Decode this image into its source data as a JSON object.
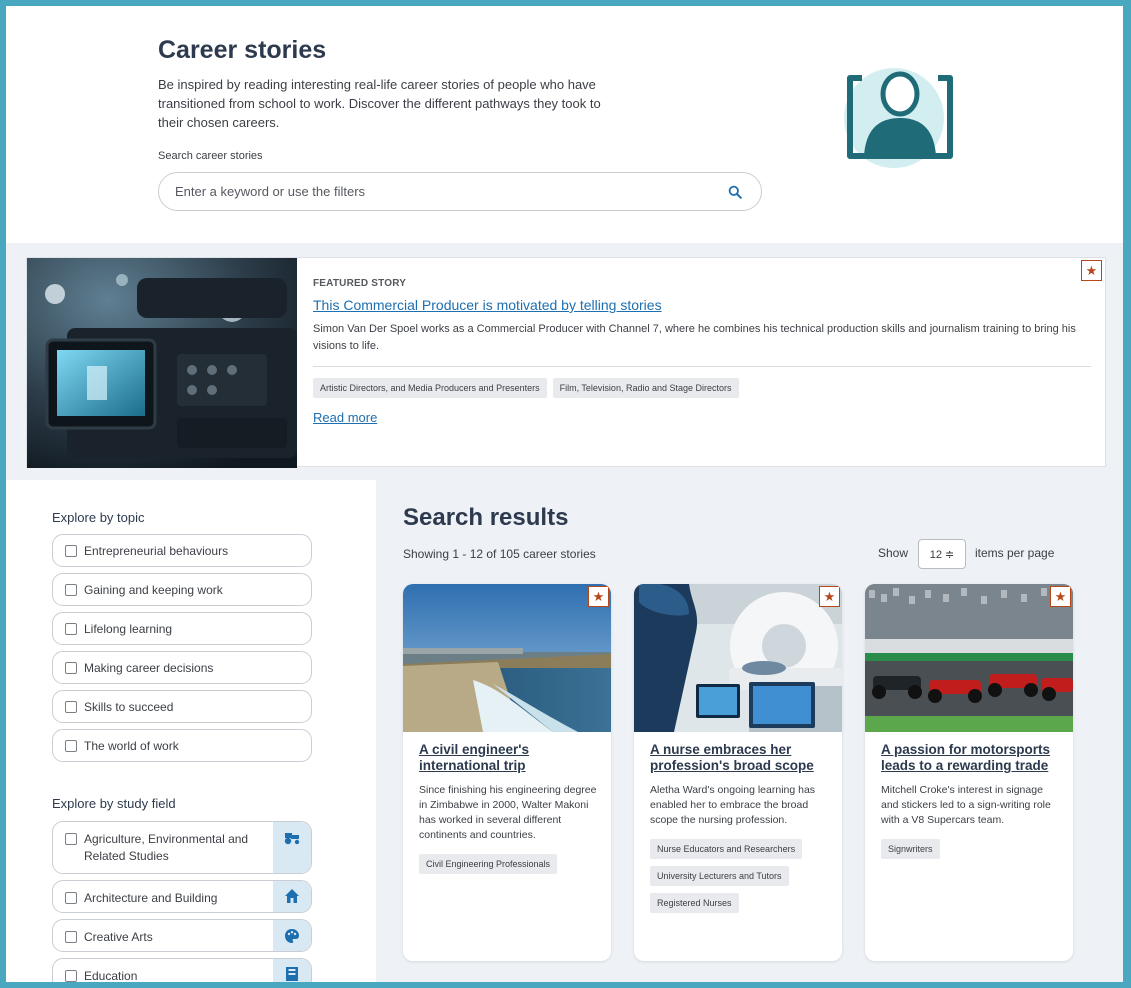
{
  "header": {
    "title": "Career stories",
    "intro": "Be inspired by reading interesting real-life career stories of people who have transitioned from school to work. Discover the different pathways they took to their chosen careers.",
    "search_label": "Search career stories",
    "search_placeholder": "Enter a keyword or use the filters",
    "search_icon": "search-icon",
    "illustration_icon": "person-in-frame-icon"
  },
  "featured": {
    "eyebrow": "FEATURED STORY",
    "title": "This Commercial Producer is motivated by telling stories",
    "description": "Simon Van Der Spoel works as a Commercial Producer with Channel 7, where he combines his technical production skills and journalism training to bring his visions to life.",
    "tags": [
      "Artistic Directors, and Media Producers and Presenters",
      "Film, Television, Radio and Stage Directors"
    ],
    "read_more": "Read more",
    "star": "★"
  },
  "sidebar": {
    "topic_heading": "Explore by topic",
    "topics": [
      {
        "label": "Entrepreneurial behaviours"
      },
      {
        "label": "Gaining and keeping work"
      },
      {
        "label": "Lifelong learning"
      },
      {
        "label": "Making career decisions"
      },
      {
        "label": "Skills to succeed"
      },
      {
        "label": "The world of work"
      }
    ],
    "study_heading": "Explore by study field",
    "study_fields": [
      {
        "label": "Agriculture, Environmental and Related Studies",
        "icon": "tractor-icon"
      },
      {
        "label": "Architecture and Building",
        "icon": "house-icon"
      },
      {
        "label": "Creative Arts",
        "icon": "palette-icon"
      },
      {
        "label": "Education",
        "icon": "book-icon"
      }
    ]
  },
  "results": {
    "title": "Search results",
    "count": "Showing 1 - 12 of 105 career stories",
    "show_label": "Show",
    "per_page": "12 ≑",
    "items_label": "items per page",
    "cards": [
      {
        "title": "A civil engineer's international trip",
        "description": "Since finishing his engineering degree in Zimbabwe in 2000, Walter Makoni has worked in several different continents and countries.",
        "tags": [
          "Civil Engineering Professionals"
        ],
        "star": "★"
      },
      {
        "title": "A nurse embraces her profession's broad scope",
        "description": "Aletha Ward's ongoing learning has enabled her to embrace the broad scope the nursing profession.",
        "tags": [
          "Nurse Educators and Researchers",
          "University Lecturers and Tutors",
          "Registered Nurses"
        ],
        "star": "★"
      },
      {
        "title": "A passion for motorsports leads to a rewarding trade",
        "description": "Mitchell Croke's interest in signage and stickers led to a sign-writing role with a V8 Supercars team.",
        "tags": [
          "Signwriters"
        ],
        "star": "★"
      }
    ]
  },
  "colors": {
    "frame": "#49a7c0",
    "heading": "#2d3a4e",
    "link": "#1d6fb0",
    "star": "#b5471b",
    "band": "#eef1f5",
    "icon_teal": "#1f6b78",
    "illustration_circle": "#d3eef1"
  }
}
